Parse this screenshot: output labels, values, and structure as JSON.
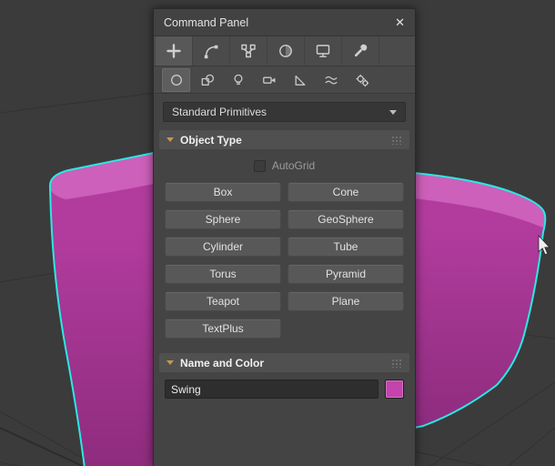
{
  "colors": {
    "viewport_bg": "#3b3b3b",
    "panel_bg": "#444444",
    "grid_line": "#323232",
    "accent_cyan": "#2ae9e4",
    "object_top": "#cd60ba",
    "object_mid": "#b23c9e",
    "object_dark": "#8e2c7e",
    "rollout_arrow": "#c9974a",
    "swatch": "#c443ad"
  },
  "panel": {
    "title": "Command Panel",
    "close_glyph": "✕",
    "tabs": [
      "create",
      "modify",
      "hierarchy",
      "motion",
      "display",
      "utilities"
    ],
    "categories": [
      "geometry",
      "shapes",
      "lights",
      "cameras",
      "helpers",
      "space-warps",
      "systems"
    ],
    "dropdown_value": "Standard Primitives",
    "object_type": {
      "title": "Object Type",
      "autogrid_label": "AutoGrid",
      "buttons": [
        "Box",
        "Cone",
        "Sphere",
        "GeoSphere",
        "Cylinder",
        "Tube",
        "Torus",
        "Pyramid",
        "Teapot",
        "Plane",
        "TextPlus"
      ]
    },
    "name_and_color": {
      "title": "Name and Color",
      "name_value": "Swing"
    }
  },
  "viewport": {
    "selected_object_name": "Swing",
    "selection_outline_color": "#2ae9e4"
  }
}
